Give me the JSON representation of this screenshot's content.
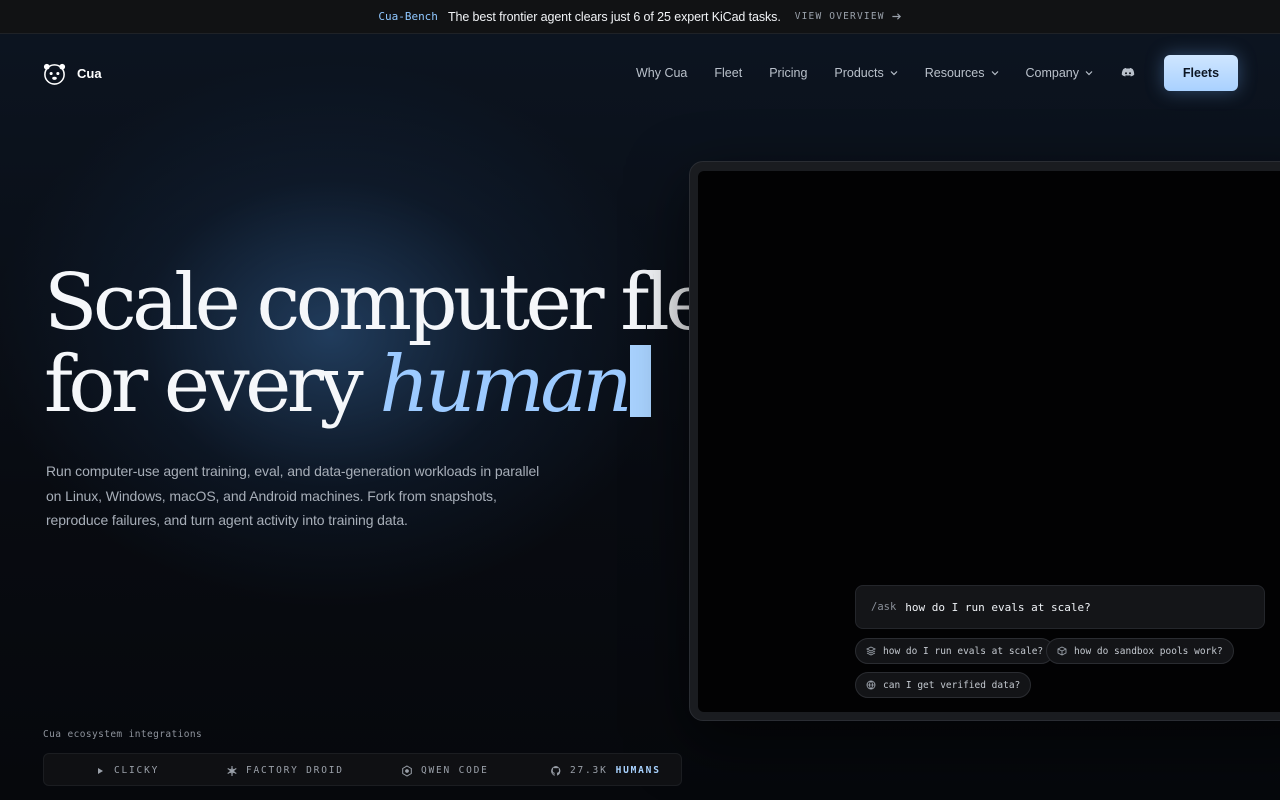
{
  "announcement": {
    "tag": "Cua-Bench",
    "message": "The best frontier agent clears just 6 of 25 expert KiCad tasks.",
    "link_label": "VIEW OVERVIEW"
  },
  "nav": {
    "brand": "Cua",
    "items": [
      {
        "label": "Why Cua",
        "dropdown": false
      },
      {
        "label": "Fleet",
        "dropdown": false
      },
      {
        "label": "Pricing",
        "dropdown": false
      },
      {
        "label": "Products",
        "dropdown": true
      },
      {
        "label": "Resources",
        "dropdown": true
      },
      {
        "label": "Company",
        "dropdown": true
      }
    ],
    "cta_label": "Fleets"
  },
  "hero": {
    "line1": "Scale computer fleets",
    "line2_prefix": "for every ",
    "line2_accent": "human",
    "subcopy": "Run computer-use agent training, eval, and data-generation workloads in parallel on Linux, Windows, macOS, and Android machines. Fork from snapshots, reproduce failures, and turn agent activity into training data."
  },
  "ask": {
    "command": "/ask",
    "query": "how do I run evals at scale?",
    "suggestions": [
      {
        "label": "how do I run evals at scale?",
        "icon": "stack-icon"
      },
      {
        "label": "how do sandbox pools work?",
        "icon": "cube-icon"
      },
      {
        "label": "can I get verified data?",
        "icon": "globe-icon"
      }
    ]
  },
  "integrations": {
    "label": "Cua ecosystem integrations",
    "items": [
      {
        "label": "CLICKY",
        "icon": "play-icon"
      },
      {
        "label": "FACTORY DROID",
        "icon": "snowflake-icon"
      },
      {
        "label": "QWEN CODE",
        "icon": "qwen-icon"
      },
      {
        "label": "27.3K",
        "highlight": "HUMANS",
        "icon": "github-icon"
      }
    ]
  },
  "colors": {
    "accent": "#9ccaff",
    "cta": "#b9dcff",
    "background": "#06080c"
  }
}
